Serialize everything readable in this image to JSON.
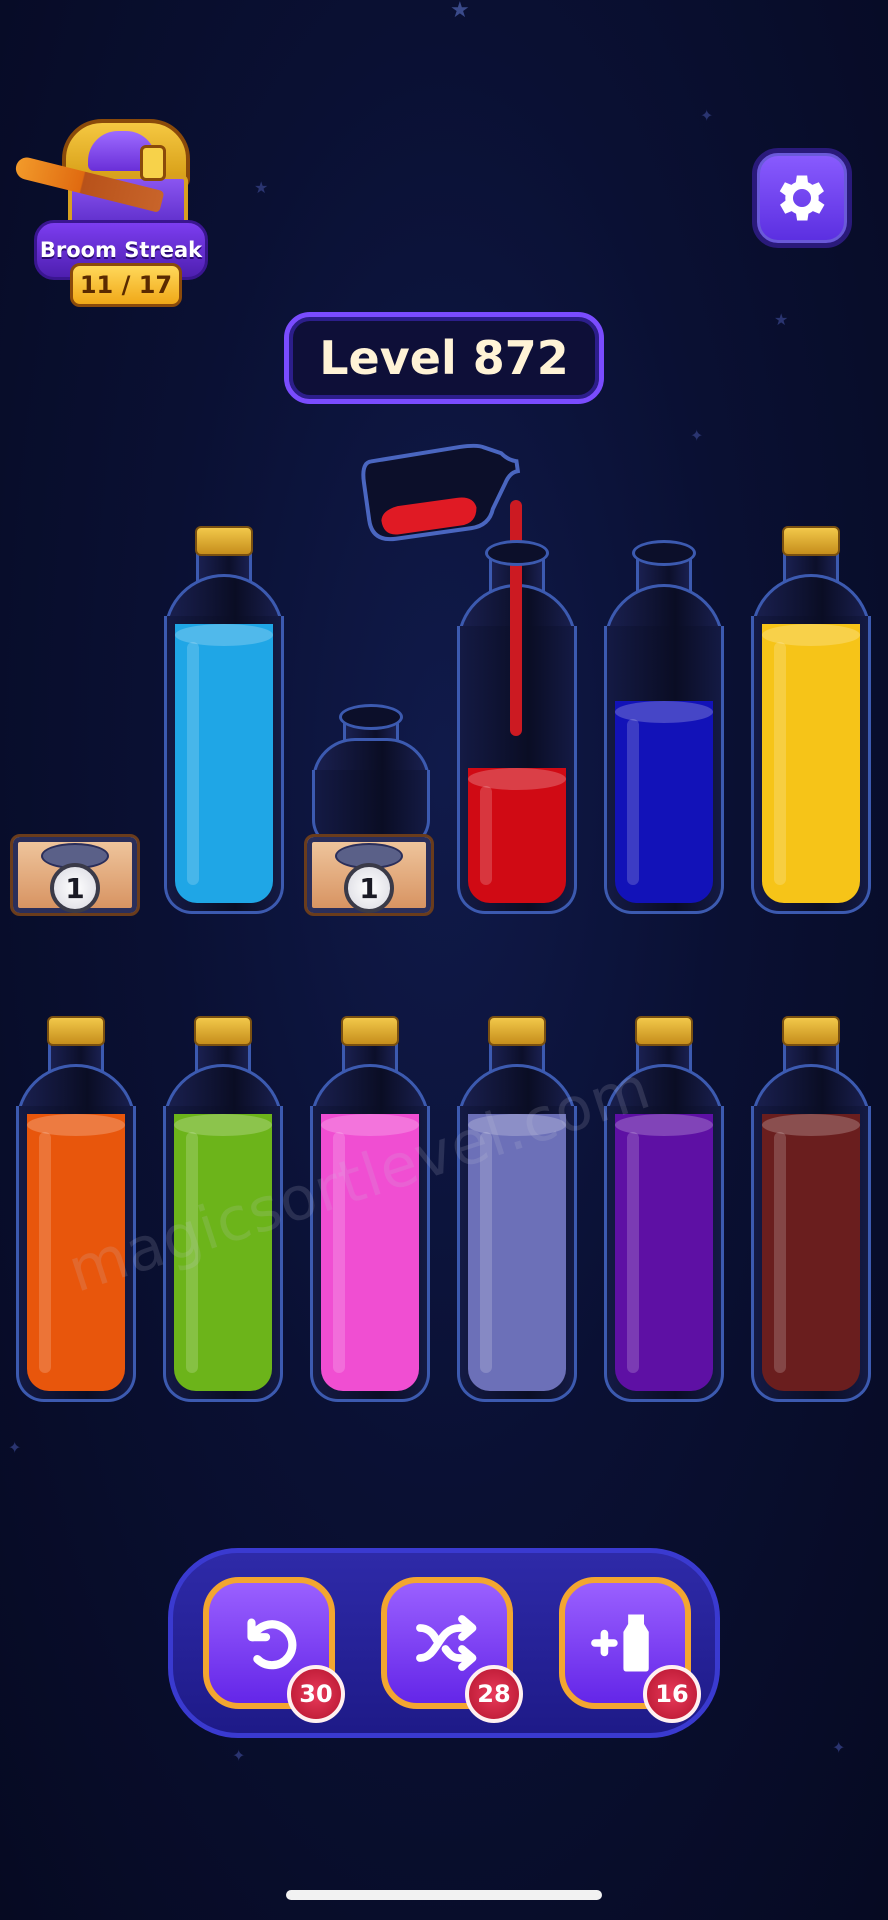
{
  "streak": {
    "title": "Broom Streak",
    "progress": "11 / 17"
  },
  "level": {
    "label": "Level 872"
  },
  "crates": [
    {
      "lock_count": "1"
    },
    {
      "lock_count": "1"
    }
  ],
  "top_row_bottles": [
    {
      "color": "#1fa6e6",
      "fill": 1.0,
      "corked": true
    },
    {
      "color": "",
      "fill": 0.0,
      "corked": false,
      "small": true
    },
    {
      "color": "#d00a14",
      "fill": 0.5,
      "corked": false
    },
    {
      "color": "#1212b8",
      "fill": 0.75,
      "corked": false
    },
    {
      "color": "#f6c418",
      "fill": 1.0,
      "corked": true
    }
  ],
  "pouring_bottle": {
    "color": "#e01a24",
    "fill": 0.25
  },
  "bottom_row_bottles": [
    {
      "color": "#e8560c",
      "fill": 1.0,
      "corked": true
    },
    {
      "color": "#6cb41a",
      "fill": 1.0,
      "corked": true
    },
    {
      "color": "#f04ed2",
      "fill": 1.0,
      "corked": true
    },
    {
      "color": "#6c70b8",
      "fill": 1.0,
      "corked": true
    },
    {
      "color": "#5e10a4",
      "fill": 1.0,
      "corked": true
    },
    {
      "color": "#6a1e1e",
      "fill": 1.0,
      "corked": true
    }
  ],
  "toolbar": {
    "undo": {
      "icon": "undo-icon",
      "count": "30"
    },
    "shuffle": {
      "icon": "shuffle-icon",
      "count": "28"
    },
    "add_bottle": {
      "icon": "add-bottle-icon",
      "count": "16"
    }
  },
  "watermark": "magicsortlevel.com"
}
